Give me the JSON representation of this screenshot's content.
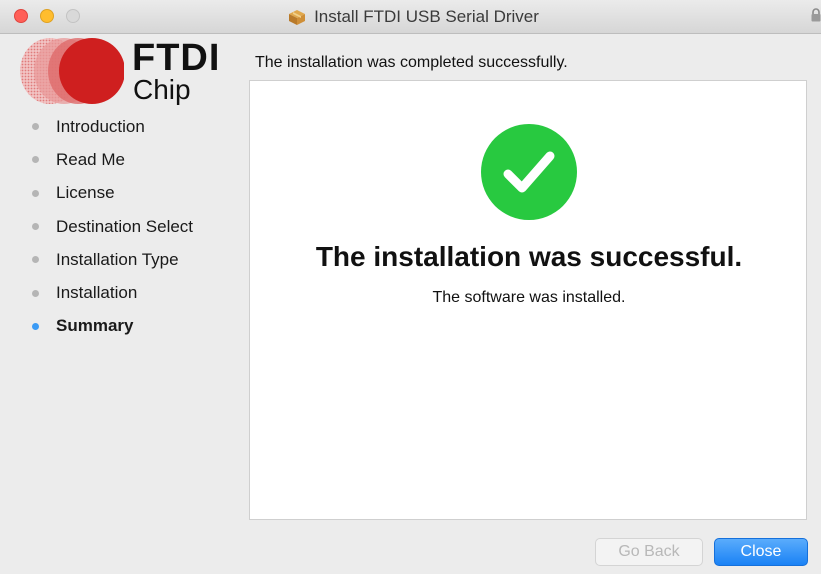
{
  "window": {
    "title": "Install FTDI USB Serial Driver"
  },
  "logo": {
    "brand": "FTDI",
    "sub": "Chip"
  },
  "sidebar": {
    "steps": [
      {
        "label": "Introduction",
        "active": false
      },
      {
        "label": "Read Me",
        "active": false
      },
      {
        "label": "License",
        "active": false
      },
      {
        "label": "Destination Select",
        "active": false
      },
      {
        "label": "Installation Type",
        "active": false
      },
      {
        "label": "Installation",
        "active": false
      },
      {
        "label": "Summary",
        "active": true
      }
    ]
  },
  "main": {
    "subtitle": "The installation was completed successfully.",
    "headline": "The installation was successful.",
    "detail": "The software was installed."
  },
  "buttons": {
    "back_label": "Go Back",
    "close_label": "Close"
  },
  "colors": {
    "accent": "#1a82f5",
    "success": "#28c940",
    "logo_red": "#d11b1b",
    "active_dot": "#3b9bf5"
  },
  "icons": {
    "title_icon": "package-icon",
    "status_icon": "checkmark-icon",
    "lock": "lock-icon"
  }
}
